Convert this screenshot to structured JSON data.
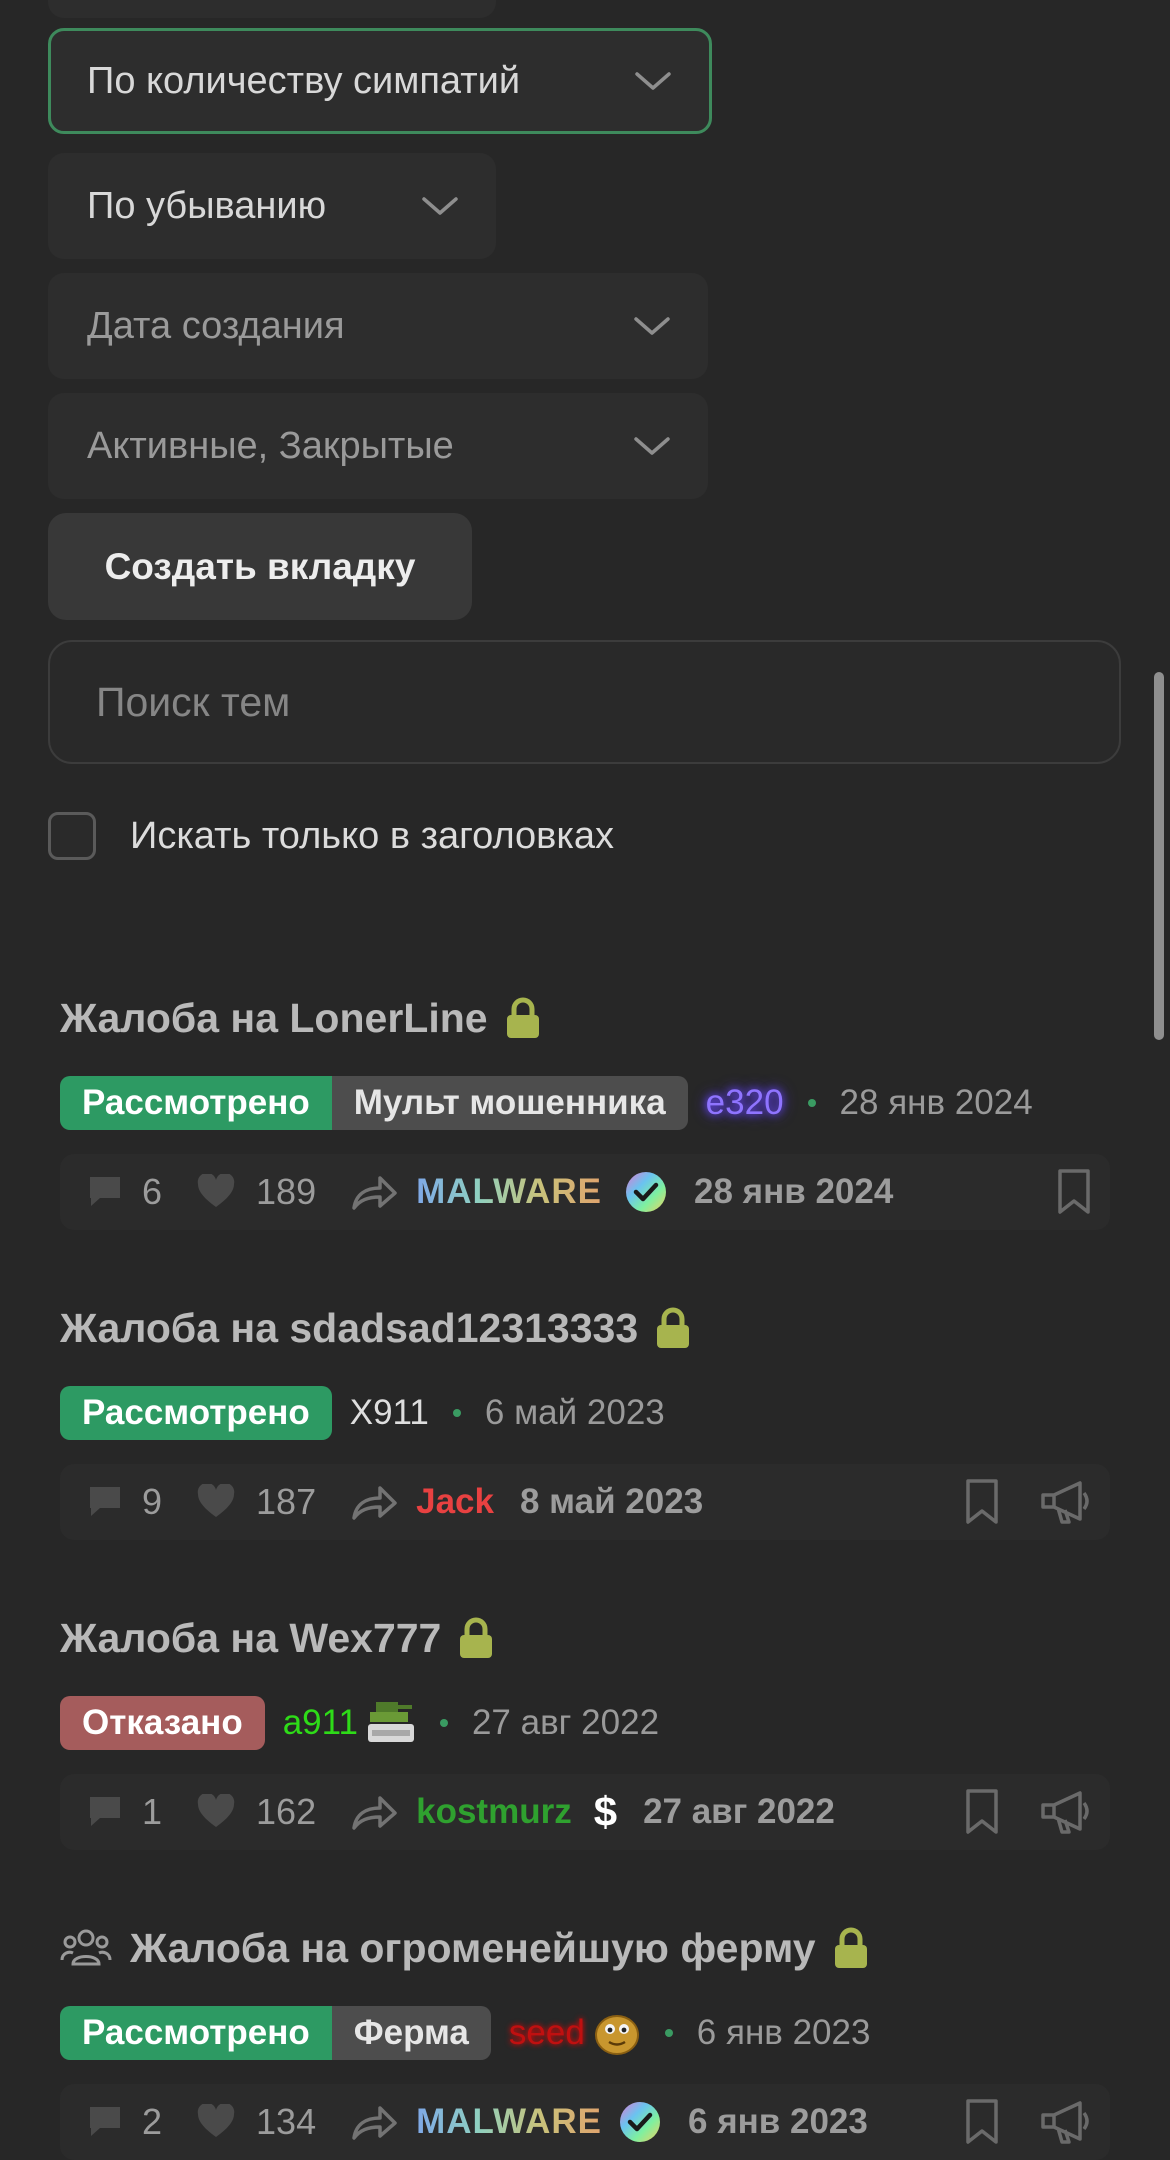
{
  "filters": {
    "sort_by": "По количеству симпатий",
    "order": "По убыванию",
    "date_field": "Дата создания",
    "state": "Активные, Закрытые"
  },
  "create_tab_label": "Создать вкладку",
  "search": {
    "placeholder": "Поиск тем",
    "value": ""
  },
  "titles_only_label": "Искать только в заголовках",
  "threads": [
    {
      "title": "Жалоба на LonerLine",
      "prefix": "Рассмотрено",
      "prefix_color": "#2d9a63",
      "tag": "Мульт мошенника",
      "author": "e320",
      "date": "28 янв 2024",
      "replies": "6",
      "likes": "189",
      "last_user": "MALWARE",
      "last_date": "28 янв 2024"
    },
    {
      "title": "Жалоба на sdadsad12313333",
      "prefix": "Рассмотрено",
      "prefix_color": "#2d9a63",
      "author": "X911",
      "date": "6 май 2023",
      "replies": "9",
      "likes": "187",
      "last_user": "Jack",
      "last_date": "8 май 2023"
    },
    {
      "title": "Жалоба на Wex777",
      "prefix": "Отказано",
      "prefix_color": "#a55c5c",
      "author": "a911",
      "date": "27 авг 2022",
      "replies": "1",
      "likes": "162",
      "last_user": "kostmurz",
      "last_user_badge": "$",
      "last_date": "27 авг 2022"
    },
    {
      "title": "Жалоба на огроменейшую ферму",
      "prefix": "Рассмотрено",
      "prefix_color": "#2d9a63",
      "tag": "Ферма",
      "author": "seed",
      "date": "6 янв 2023",
      "replies": "2",
      "likes": "134",
      "last_user": "MALWARE",
      "last_date": "6 янв 2023"
    }
  ]
}
